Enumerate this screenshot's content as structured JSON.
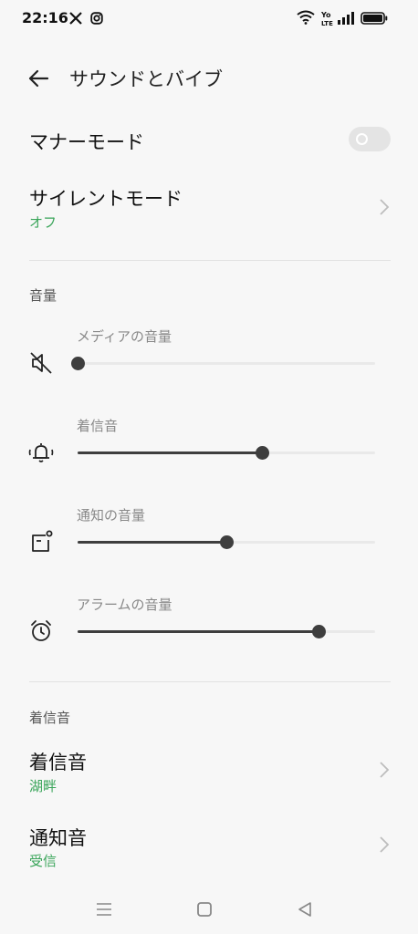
{
  "status_bar": {
    "time": "22:16",
    "icons": [
      "x-app-icon",
      "instagram-icon",
      "wifi-icon",
      "volte-icon",
      "signal-icon",
      "battery-icon"
    ]
  },
  "header": {
    "title": "サウンドとバイブ",
    "back_icon": "back-arrow-icon"
  },
  "manner_mode": {
    "label": "マナーモード",
    "toggle_on": false
  },
  "silent_mode": {
    "label": "サイレントモード",
    "value": "オフ"
  },
  "volume_section": {
    "title": "音量",
    "sliders": [
      {
        "label": "メディアの音量",
        "icon": "media-muted-icon",
        "level": 0.0
      },
      {
        "label": "着信音",
        "icon": "ringing-bell-icon",
        "level": 0.62
      },
      {
        "label": "通知の音量",
        "icon": "notification-icon",
        "level": 0.5
      },
      {
        "label": "アラームの音量",
        "icon": "alarm-clock-icon",
        "level": 0.81
      }
    ]
  },
  "ringtone_section": {
    "title": "着信音",
    "items": [
      {
        "label": "着信音",
        "value": "湖畔"
      },
      {
        "label": "通知音",
        "value": "受信"
      }
    ]
  },
  "nav_bar": {
    "buttons": [
      "menu-icon",
      "home-icon",
      "back-triangle-icon"
    ]
  },
  "colors": {
    "accent_green": "#3aa55a",
    "slider_fill": "#3e3e3e",
    "background": "#f7f7f7"
  }
}
